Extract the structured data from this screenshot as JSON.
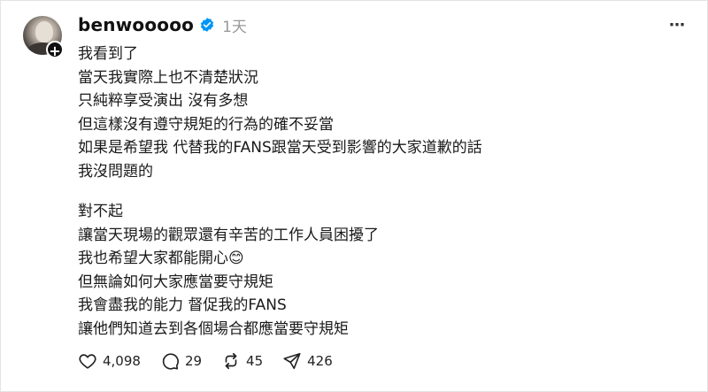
{
  "post": {
    "username": "benwooooo",
    "time": "1天",
    "more_icon": "⋯",
    "follow_icon": "+",
    "verified_color": "#0095f6",
    "paragraphs": [
      [
        "我看到了",
        "當天我實際上也不清楚狀況",
        "只純粹享受演出 沒有多想",
        "但這樣沒有遵守規矩的行為的確不妥當",
        "如果是希望我 代替我的FANS跟當天受到影響的大家道歉的話",
        "我沒問題的"
      ],
      [
        "對不起",
        "讓當天現場的觀眾還有辛苦的工作人員困擾了",
        "我也希望大家都能開心😊",
        "但無論如何大家應當要守規矩",
        "我會盡我的能力 督促我的FANS",
        "讓他們知道去到各個場合都應當要守規矩"
      ]
    ]
  },
  "actions": {
    "likes": "4,098",
    "comments": "29",
    "reposts": "45",
    "shares": "426"
  }
}
